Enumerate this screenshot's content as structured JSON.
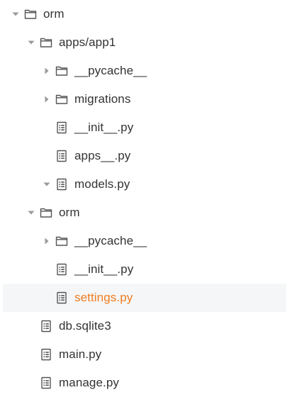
{
  "theme": {
    "text_color": "#333333",
    "selected_text_color": "#ef7d20",
    "selected_row_bg": "#f5f6f8",
    "icon_color": "#555555",
    "toggle_color": "#9a9a9a"
  },
  "tree": {
    "nodes": [
      {
        "label": "orm",
        "type": "folder",
        "toggle": "expanded",
        "depth": 0,
        "selected": false
      },
      {
        "label": "apps/app1",
        "type": "folder",
        "toggle": "expanded",
        "depth": 1,
        "selected": false
      },
      {
        "label": "__pycache__",
        "type": "folder",
        "toggle": "collapsed",
        "depth": 2,
        "selected": false
      },
      {
        "label": "migrations",
        "type": "folder",
        "toggle": "collapsed",
        "depth": 2,
        "selected": false
      },
      {
        "label": "__init__.py",
        "type": "file",
        "toggle": "none",
        "depth": 2,
        "selected": false
      },
      {
        "label": "apps__.py",
        "type": "file",
        "toggle": "none",
        "depth": 2,
        "selected": false
      },
      {
        "label": "models.py",
        "type": "file",
        "toggle": "expanded",
        "depth": 2,
        "selected": false
      },
      {
        "label": "orm",
        "type": "folder",
        "toggle": "expanded",
        "depth": 1,
        "selected": false
      },
      {
        "label": "__pycache__",
        "type": "folder",
        "toggle": "collapsed",
        "depth": 2,
        "selected": false
      },
      {
        "label": "__init__.py",
        "type": "file",
        "toggle": "none",
        "depth": 2,
        "selected": false
      },
      {
        "label": "settings.py",
        "type": "file",
        "toggle": "none",
        "depth": 2,
        "selected": true
      },
      {
        "label": "db.sqlite3",
        "type": "file",
        "toggle": "none",
        "depth": 1,
        "selected": false
      },
      {
        "label": "main.py",
        "type": "file",
        "toggle": "none",
        "depth": 1,
        "selected": false
      },
      {
        "label": "manage.py",
        "type": "file",
        "toggle": "none",
        "depth": 1,
        "selected": false
      }
    ]
  }
}
